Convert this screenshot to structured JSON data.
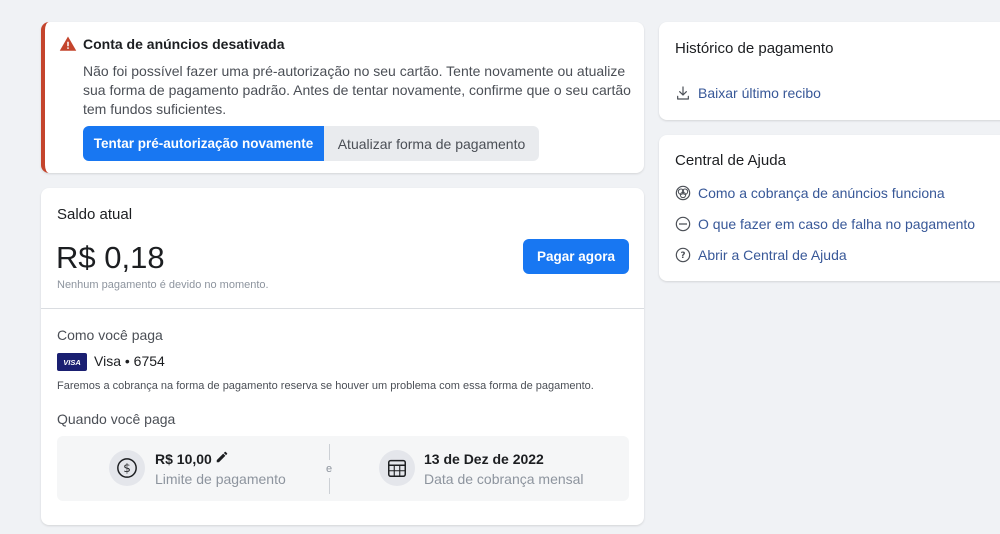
{
  "alert": {
    "title": "Conta de anúncios desativada",
    "body": "Não foi possível fazer uma pré-autorização no seu cartão. Tente novamente ou atualize sua forma de pagamento padrão. Antes de tentar novamente, confirme que o seu cartão tem fundos suficientes.",
    "retry_label": "Tentar pré-autorização novamente",
    "update_label": "Atualizar forma de pagamento",
    "icon": "warning-icon",
    "accent_color": "#c4442c"
  },
  "balance": {
    "title": "Saldo atual",
    "amount": "R$ 0,18",
    "note": "Nenhum pagamento é devido no momento.",
    "pay_label": "Pagar agora"
  },
  "payment_method": {
    "title": "Como você paga",
    "card_brand": "VISA",
    "card_label": "Visa • 6754",
    "backup_note": "Faremos a cobrança na forma de pagamento reserva se houver um problema com essa forma de pagamento."
  },
  "when": {
    "title": "Quando você paga",
    "limit_value": "R$ 10,00",
    "limit_label": "Limite de pagamento",
    "and_label": "e",
    "date_value": "13 de Dez de 2022",
    "date_label": "Data de cobrança mensal"
  },
  "history": {
    "title": "Histórico de pagamento",
    "download_label": "Baixar último recibo"
  },
  "help": {
    "title": "Central de Ajuda",
    "links": [
      {
        "label": "Como a cobrança de anúncios funciona",
        "icon": "billing-icon"
      },
      {
        "label": "O que fazer em caso de falha no pagamento",
        "icon": "minus-circle-icon"
      },
      {
        "label": "Abrir a Central de Ajuda",
        "icon": "question-icon"
      }
    ]
  },
  "colors": {
    "primary": "#1877f2",
    "link": "#385898",
    "background": "#f0f2f5"
  }
}
